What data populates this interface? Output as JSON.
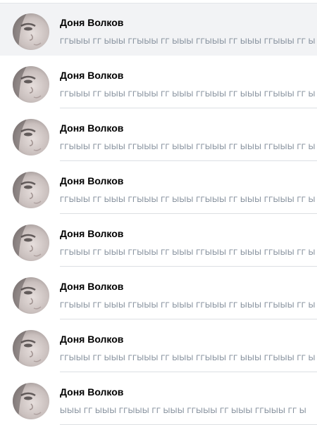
{
  "chats": [
    {
      "name": "Доня Волков",
      "preview": "ГГЫЫЫ ГГ ЫЫЫ ГГЫЫЫ ГГ ЫЫЫ ГГЫЫЫ ГГ ЫЫЫ ГГЫЫЫ ГГ Ы",
      "selected": true
    },
    {
      "name": "Доня Волков",
      "preview": "ГГЫЫЫ ГГ ЫЫЫ ГГЫЫЫ ГГ ЫЫЫ ГГЫЫЫ ГГ ЫЫЫ ГГЫЫЫ ГГ Ы",
      "selected": false
    },
    {
      "name": "Доня Волков",
      "preview": "ГГЫЫЫ ГГ ЫЫЫ ГГЫЫЫ ГГ ЫЫЫ ГГЫЫЫ ГГ ЫЫЫ ГГЫЫЫ ГГ Ы",
      "selected": false
    },
    {
      "name": "Доня Волков",
      "preview": "ГГЫЫЫ ГГ ЫЫЫ ГГЫЫЫ ГГ ЫЫЫ ГГЫЫЫ ГГ ЫЫЫ ГГЫЫЫ ГГ Ы",
      "selected": false
    },
    {
      "name": "Доня Волков",
      "preview": "ГГЫЫЫ ГГ ЫЫЫ ГГЫЫЫ ГГ ЫЫЫ ГГЫЫЫ ГГ ЫЫЫ ГГЫЫЫ ГГ Ы",
      "selected": false
    },
    {
      "name": "Доня Волков",
      "preview": "ГГЫЫЫ ГГ ЫЫЫ ГГЫЫЫ ГГ ЫЫЫ ГГЫЫЫ ГГ ЫЫЫ ГГЫЫЫ ГГ Ы",
      "selected": false
    },
    {
      "name": "Доня Волков",
      "preview": "ГГЫЫЫ ГГ ЫЫЫ ГГЫЫЫ ГГ ЫЫЫ ГГЫЫЫ ГГ ЫЫЫ ГГЫЫЫ ГГ Ы",
      "selected": false
    },
    {
      "name": "Доня Волков",
      "preview": "ЫЫЫ ГГ ЫЫЫ ГГЫЫЫ ГГ ЫЫЫ ГГЫЫЫ ГГ ЫЫЫ ГГЫЫЫ ГГ Ы",
      "selected": false
    }
  ],
  "colors": {
    "selected_background": "#f2f3f5",
    "name_text": "#000000",
    "preview_text": "#818c99",
    "divider": "#dcdfe3"
  },
  "icons": {
    "avatar": "user-photo"
  }
}
